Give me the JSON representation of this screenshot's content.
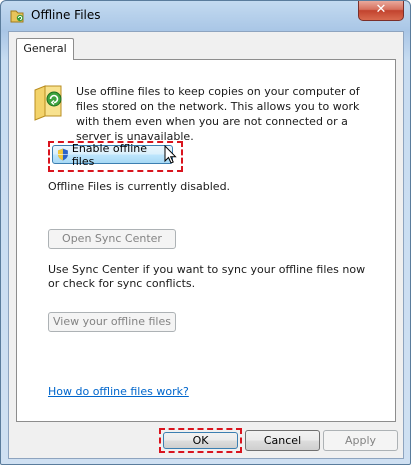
{
  "window": {
    "title": "Offline Files",
    "close_glyph": "✕"
  },
  "tabs": [
    {
      "label": "General"
    }
  ],
  "general": {
    "intro_text": "Use offline files to keep copies on your computer of files stored on the network.  This allows you to work with them even when you are not connected or a server is unavailable.",
    "enable_button": "Enable offline files",
    "status_text": "Offline Files is currently disabled.",
    "sync_button": "Open Sync Center",
    "sync_description": "Use Sync Center if you want to sync your offline files now or check for sync conflicts.",
    "view_button": "View your offline files",
    "help_link": "How do offline files work?"
  },
  "footer": {
    "ok": "OK",
    "cancel": "Cancel",
    "apply": "Apply"
  },
  "icons": {
    "title": "offline-files-icon",
    "folder": "sync-folder-icon",
    "shield": "uac-shield-icon",
    "cursor": "mouse-pointer-icon"
  },
  "colors": {
    "highlight_border": "#d9141e",
    "link": "#0066cc",
    "disabled_text": "#838383"
  }
}
